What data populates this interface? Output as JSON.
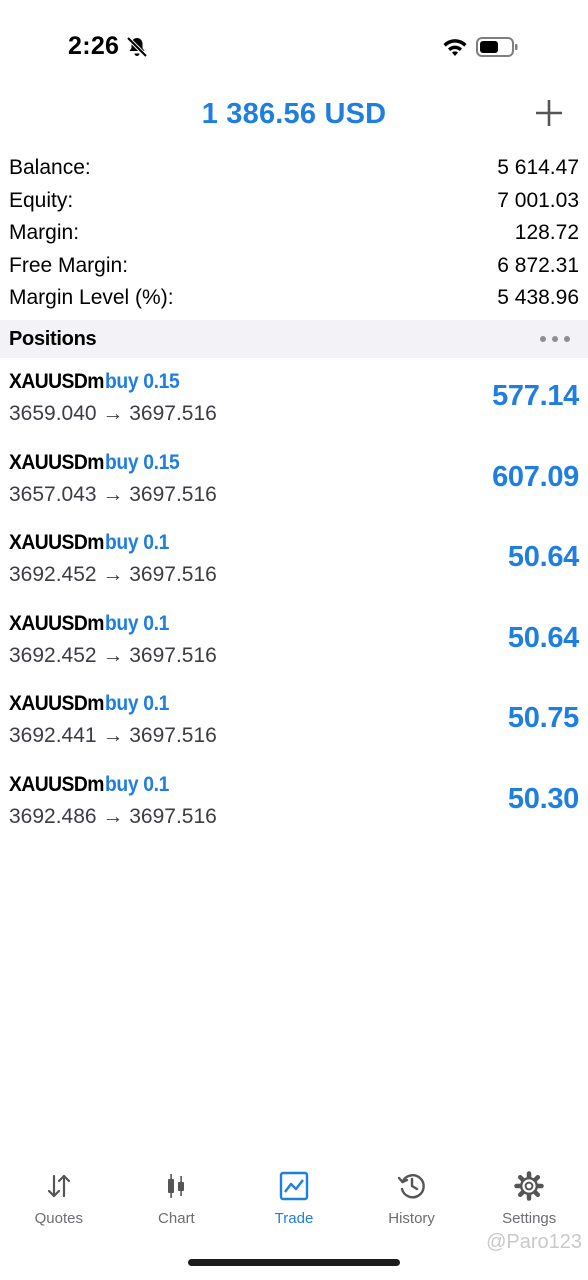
{
  "status_bar": {
    "time": "2:26"
  },
  "header": {
    "title": "1 386.56 USD"
  },
  "account": [
    {
      "label": "Balance:",
      "value": "5 614.47"
    },
    {
      "label": "Equity:",
      "value": "7 001.03"
    },
    {
      "label": "Margin:",
      "value": "128.72"
    },
    {
      "label": "Free Margin:",
      "value": "6 872.31"
    },
    {
      "label": "Margin Level (%):",
      "value": "5 438.96"
    }
  ],
  "positions_section": {
    "title": "Positions"
  },
  "positions": [
    {
      "symbol": "XAUUSDm",
      "type": "buy 0.15",
      "prices": "3659.040 → 3697.516",
      "profit": "577.14"
    },
    {
      "symbol": "XAUUSDm",
      "type": "buy 0.15",
      "prices": "3657.043 → 3697.516",
      "profit": "607.09"
    },
    {
      "symbol": "XAUUSDm",
      "type": "buy 0.1",
      "prices": "3692.452 → 3697.516",
      "profit": "50.64"
    },
    {
      "symbol": "XAUUSDm",
      "type": "buy 0.1",
      "prices": "3692.452 → 3697.516",
      "profit": "50.64"
    },
    {
      "symbol": "XAUUSDm",
      "type": "buy 0.1",
      "prices": "3692.441 → 3697.516",
      "profit": "50.75"
    },
    {
      "symbol": "XAUUSDm",
      "type": "buy 0.1",
      "prices": "3692.486 → 3697.516",
      "profit": "50.30"
    }
  ],
  "tabs": [
    {
      "label": "Quotes",
      "icon": "quotes-icon"
    },
    {
      "label": "Chart",
      "icon": "chart-icon"
    },
    {
      "label": "Trade",
      "icon": "trade-icon",
      "active": true
    },
    {
      "label": "History",
      "icon": "history-icon"
    },
    {
      "label": "Settings",
      "icon": "settings-icon"
    }
  ],
  "watermark": "@Paro123",
  "colors": {
    "accent": "#1f7ee0",
    "section_bg": "#f2f2f7",
    "tab_inactive": "#6d6d72"
  }
}
